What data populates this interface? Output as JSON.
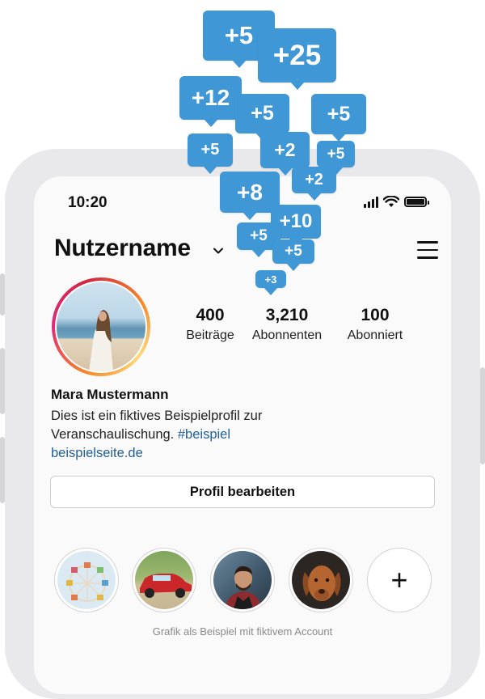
{
  "status_bar": {
    "time": "10:20"
  },
  "profile": {
    "username": "Nutzername",
    "stats": [
      {
        "value": "400",
        "label": "Beiträge"
      },
      {
        "value": "3,210",
        "label": "Abonnenten"
      },
      {
        "value": "100",
        "label": "Abonniert"
      }
    ],
    "name": "Mara Mustermann",
    "bio_line1": "Dies ist ein fiktives Beispielprofil zur",
    "bio_line2": "Veranschaulischung.",
    "hashtag": "#beispiel",
    "website": "beispielseite.de",
    "edit_button": "Profil bearbeiten"
  },
  "highlights": [
    {
      "icon": "ferris-wheel"
    },
    {
      "icon": "red-car"
    },
    {
      "icon": "man-portrait"
    },
    {
      "icon": "dog-portrait"
    },
    {
      "icon": "plus-icon",
      "label": "+"
    }
  ],
  "like_bubbles": [
    "+5",
    "+25",
    "+12",
    "+5",
    "+5",
    "+5",
    "+2",
    "+5",
    "+8",
    "+2",
    "+10",
    "+5",
    "+5",
    "+3"
  ],
  "caption": "Grafik als Beispiel mit fiktivem Account",
  "colors": {
    "accent_blue": "#3f97d6",
    "link_blue": "#1f5f99",
    "frame_gray": "#e9e9eb"
  }
}
